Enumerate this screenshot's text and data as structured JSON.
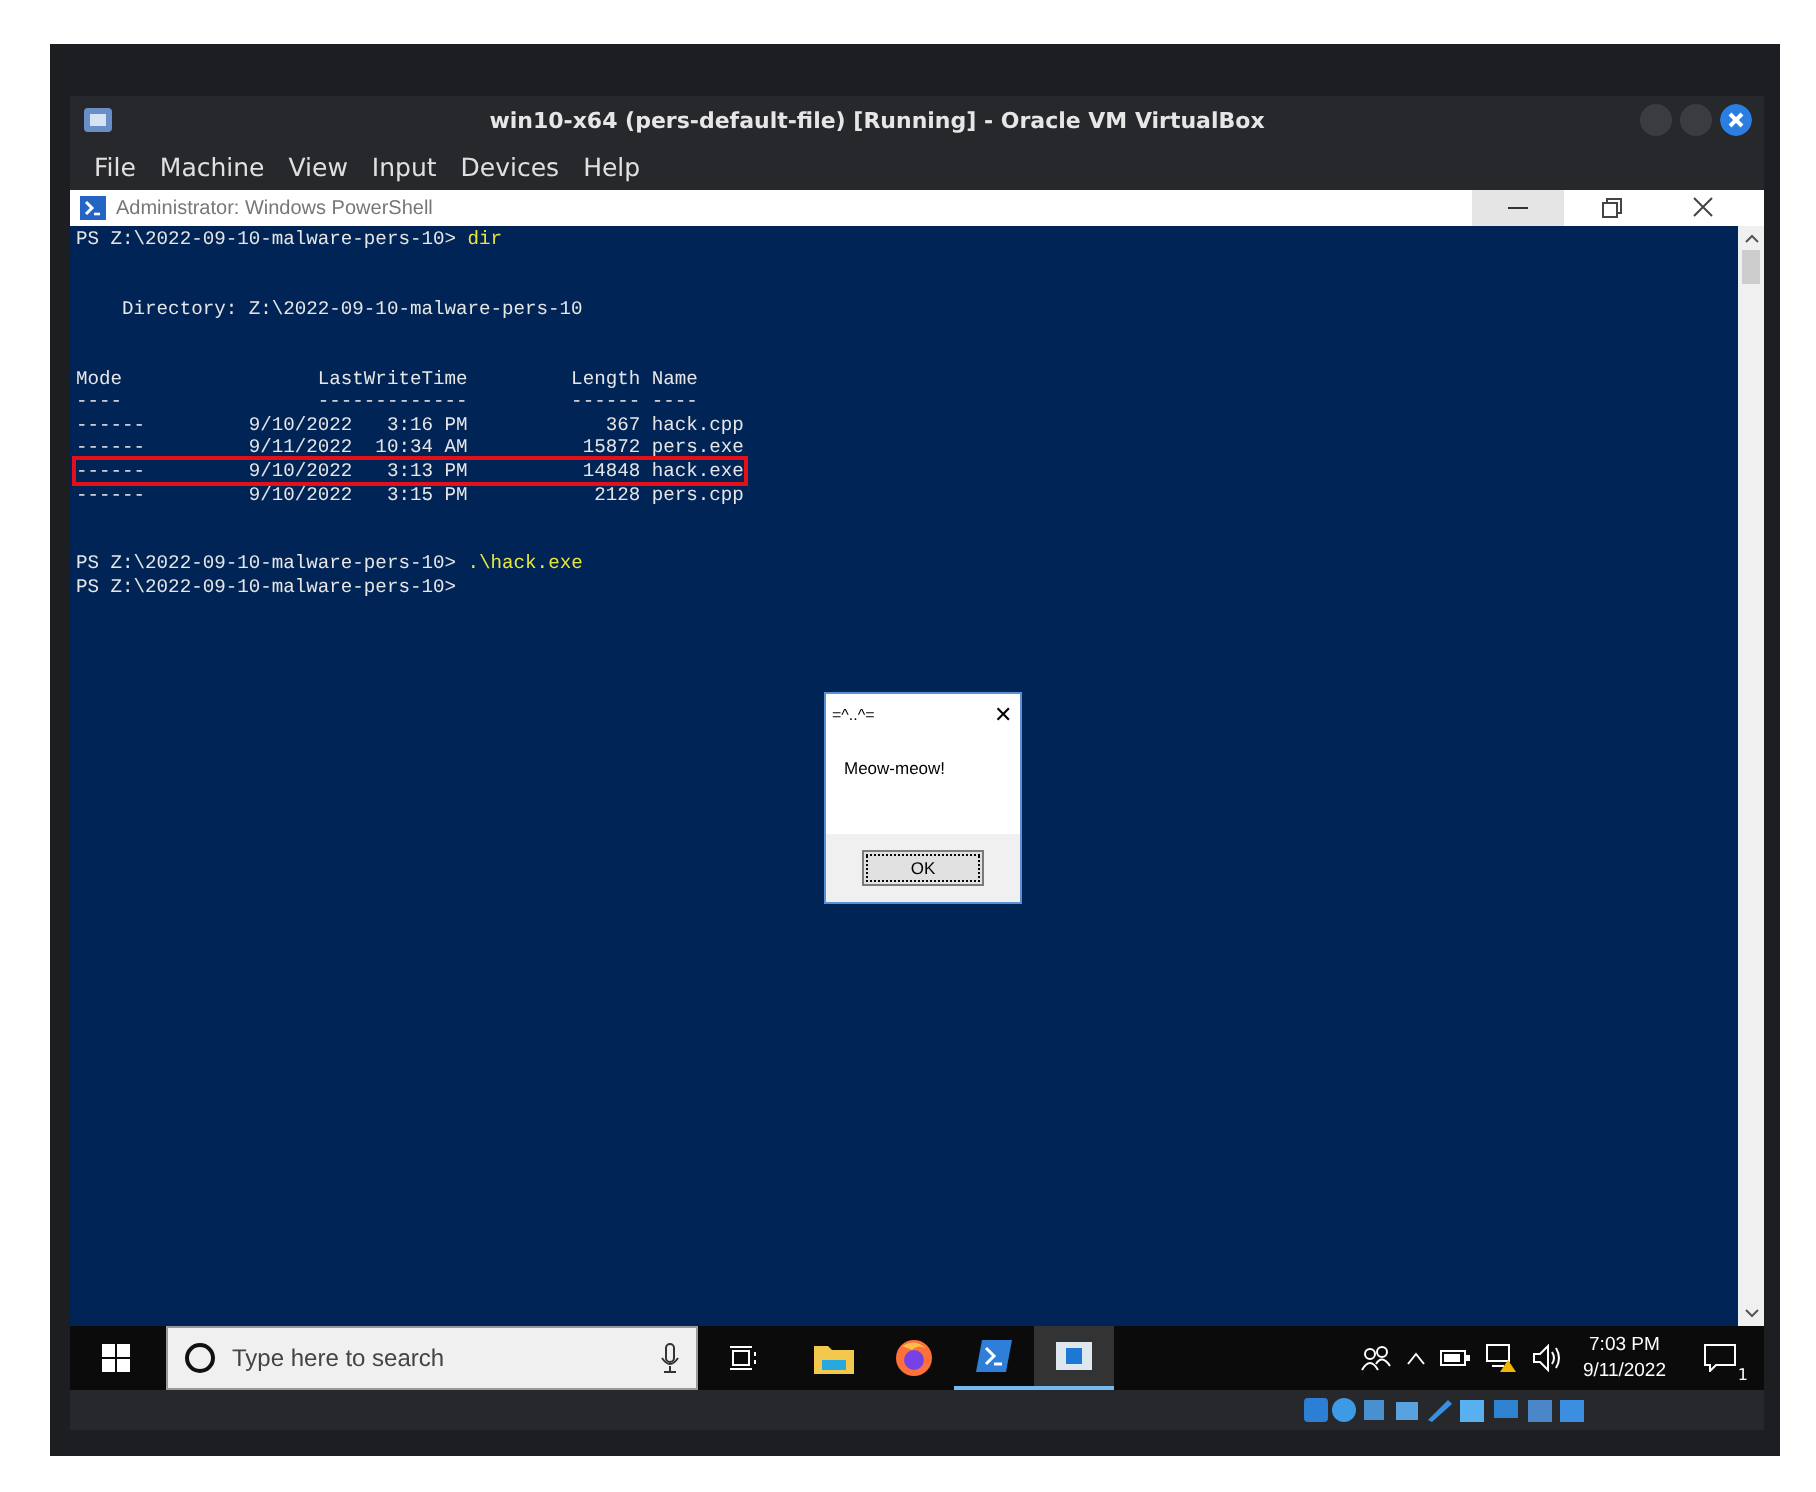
{
  "window": {
    "title": "win10-x64 (pers-default-file) [Running] - Oracle VM VirtualBox"
  },
  "menu": [
    "File",
    "Machine",
    "View",
    "Input",
    "Devices",
    "Help"
  ],
  "powershell": {
    "title": "Administrator: Windows PowerShell"
  },
  "console": {
    "lines": [
      {
        "kind": "prompt",
        "prompt": "PS Z:\\2022-09-10-malware-pers-10>",
        "command": "dir"
      },
      {
        "kind": "blank"
      },
      {
        "kind": "blank"
      },
      {
        "kind": "text",
        "text": "    Directory: Z:\\2022-09-10-malware-pers-10"
      },
      {
        "kind": "blank"
      },
      {
        "kind": "blank"
      },
      {
        "kind": "text",
        "text": "Mode                 LastWriteTime         Length Name"
      },
      {
        "kind": "text",
        "text": "----                 -------------         ------ ----"
      },
      {
        "kind": "text",
        "text": "------         9/10/2022   3:16 PM            367 hack.cpp",
        "highlighted": false
      },
      {
        "kind": "text",
        "text": "------         9/11/2022  10:34 AM          15872 pers.exe",
        "highlighted": false
      },
      {
        "kind": "text",
        "text": "------         9/10/2022   3:13 PM          14848 hack.exe",
        "highlighted": true
      },
      {
        "kind": "text",
        "text": "------         9/10/2022   3:15 PM           2128 pers.cpp",
        "highlighted": false
      },
      {
        "kind": "blank"
      },
      {
        "kind": "blank"
      },
      {
        "kind": "prompt",
        "prompt": "PS Z:\\2022-09-10-malware-pers-10>",
        "command": ".\\hack.exe"
      },
      {
        "kind": "prompt",
        "prompt": "PS Z:\\2022-09-10-malware-pers-10>"
      }
    ]
  },
  "dialog": {
    "title": "=^..^=",
    "close": "✕",
    "message": "Meow-meow!",
    "button": "OK"
  },
  "taskbar": {
    "search": {
      "placeholder": "Type here to search"
    },
    "apps": [
      {
        "kind": "explorer",
        "running": false,
        "selected": false
      },
      {
        "kind": "firefox",
        "running": false,
        "selected": false
      },
      {
        "kind": "powershell",
        "running": true,
        "selected": false
      },
      {
        "kind": "window",
        "running": true,
        "selected": true
      }
    ],
    "time": "7:03 PM",
    "date": "9/11/2022",
    "notifications": "1"
  }
}
